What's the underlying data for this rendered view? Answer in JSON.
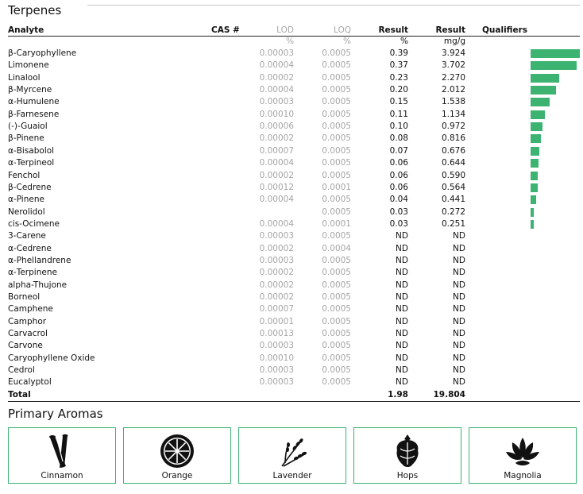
{
  "terpenes": {
    "title": "Terpenes",
    "headers": {
      "analyte": "Analyte",
      "cas": "CAS #",
      "lod": "LOD",
      "loq": "LOQ",
      "result_pct": "Result",
      "result_mg": "Result",
      "qualifiers": "Qualifiers"
    },
    "units": {
      "lod": "%",
      "loq": "%",
      "result_pct": "%",
      "result_mg": "mg/g"
    },
    "rows": [
      {
        "analyte": "β-Caryophyllene",
        "lod": "0.00003",
        "loq": "0.0005",
        "pct": "0.39",
        "mg": "3.924",
        "bar": 3.924
      },
      {
        "analyte": "Limonene",
        "lod": "0.00004",
        "loq": "0.0005",
        "pct": "0.37",
        "mg": "3.702",
        "bar": 3.702
      },
      {
        "analyte": "Linalool",
        "lod": "0.00002",
        "loq": "0.0005",
        "pct": "0.23",
        "mg": "2.270",
        "bar": 2.27
      },
      {
        "analyte": "β-Myrcene",
        "lod": "0.00004",
        "loq": "0.0005",
        "pct": "0.20",
        "mg": "2.012",
        "bar": 2.012
      },
      {
        "analyte": "α-Humulene",
        "lod": "0.00003",
        "loq": "0.0005",
        "pct": "0.15",
        "mg": "1.538",
        "bar": 1.538
      },
      {
        "analyte": "β-Farnesene",
        "lod": "0.00010",
        "loq": "0.0005",
        "pct": "0.11",
        "mg": "1.134",
        "bar": 1.134
      },
      {
        "analyte": "(-)-Guaiol",
        "lod": "0.00006",
        "loq": "0.0005",
        "pct": "0.10",
        "mg": "0.972",
        "bar": 0.972
      },
      {
        "analyte": "β-Pinene",
        "lod": "0.00002",
        "loq": "0.0005",
        "pct": "0.08",
        "mg": "0.816",
        "bar": 0.816
      },
      {
        "analyte": "α-Bisabolol",
        "lod": "0.00007",
        "loq": "0.0005",
        "pct": "0.07",
        "mg": "0.676",
        "bar": 0.676
      },
      {
        "analyte": "α-Terpineol",
        "lod": "0.00004",
        "loq": "0.0005",
        "pct": "0.06",
        "mg": "0.644",
        "bar": 0.644
      },
      {
        "analyte": "Fenchol",
        "lod": "0.00002",
        "loq": "0.0005",
        "pct": "0.06",
        "mg": "0.590",
        "bar": 0.59
      },
      {
        "analyte": "β-Cedrene",
        "lod": "0.00012",
        "loq": "0.0001",
        "pct": "0.06",
        "mg": "0.564",
        "bar": 0.564
      },
      {
        "analyte": "α-Pinene",
        "lod": "0.00004",
        "loq": "0.0005",
        "pct": "0.04",
        "mg": "0.441",
        "bar": 0.441
      },
      {
        "analyte": "Nerolidol",
        "lod": "",
        "loq": "0.0005",
        "pct": "0.03",
        "mg": "0.272",
        "bar": 0.272
      },
      {
        "analyte": "cis-Ocimene",
        "lod": "0.00004",
        "loq": "0.0001",
        "pct": "0.03",
        "mg": "0.251",
        "bar": 0.251
      },
      {
        "analyte": "3-Carene",
        "lod": "0.00003",
        "loq": "0.0005",
        "pct": "ND",
        "mg": "ND",
        "bar": 0
      },
      {
        "analyte": "α-Cedrene",
        "lod": "0.00002",
        "loq": "0.0004",
        "pct": "ND",
        "mg": "ND",
        "bar": 0
      },
      {
        "analyte": "α-Phellandrene",
        "lod": "0.00003",
        "loq": "0.0005",
        "pct": "ND",
        "mg": "ND",
        "bar": 0
      },
      {
        "analyte": "α-Terpinene",
        "lod": "0.00002",
        "loq": "0.0005",
        "pct": "ND",
        "mg": "ND",
        "bar": 0
      },
      {
        "analyte": "alpha-Thujone",
        "lod": "0.00002",
        "loq": "0.0005",
        "pct": "ND",
        "mg": "ND",
        "bar": 0
      },
      {
        "analyte": "Borneol",
        "lod": "0.00002",
        "loq": "0.0005",
        "pct": "ND",
        "mg": "ND",
        "bar": 0
      },
      {
        "analyte": "Camphene",
        "lod": "0.00007",
        "loq": "0.0005",
        "pct": "ND",
        "mg": "ND",
        "bar": 0
      },
      {
        "analyte": "Camphor",
        "lod": "0.00001",
        "loq": "0.0005",
        "pct": "ND",
        "mg": "ND",
        "bar": 0
      },
      {
        "analyte": "Carvacrol",
        "lod": "0.00013",
        "loq": "0.0005",
        "pct": "ND",
        "mg": "ND",
        "bar": 0
      },
      {
        "analyte": "Carvone",
        "lod": "0.00003",
        "loq": "0.0005",
        "pct": "ND",
        "mg": "ND",
        "bar": 0
      },
      {
        "analyte": "Caryophyllene Oxide",
        "lod": "0.00010",
        "loq": "0.0005",
        "pct": "ND",
        "mg": "ND",
        "bar": 0
      },
      {
        "analyte": "Cedrol",
        "lod": "0.00003",
        "loq": "0.0005",
        "pct": "ND",
        "mg": "ND",
        "bar": 0
      },
      {
        "analyte": "Eucalyptol",
        "lod": "0.00003",
        "loq": "0.0005",
        "pct": "ND",
        "mg": "ND",
        "bar": 0
      }
    ],
    "total": {
      "label": "Total",
      "pct": "1.98",
      "mg": "19.804"
    },
    "bar_color": "#3cb371"
  },
  "aromas": {
    "title": "Primary Aromas",
    "border_color": "#3cb371",
    "items": [
      {
        "label": "Cinnamon",
        "icon": "cinnamon-icon"
      },
      {
        "label": "Orange",
        "icon": "orange-icon"
      },
      {
        "label": "Lavender",
        "icon": "lavender-icon"
      },
      {
        "label": "Hops",
        "icon": "hops-icon"
      },
      {
        "label": "Magnolia",
        "icon": "magnolia-icon"
      }
    ]
  }
}
